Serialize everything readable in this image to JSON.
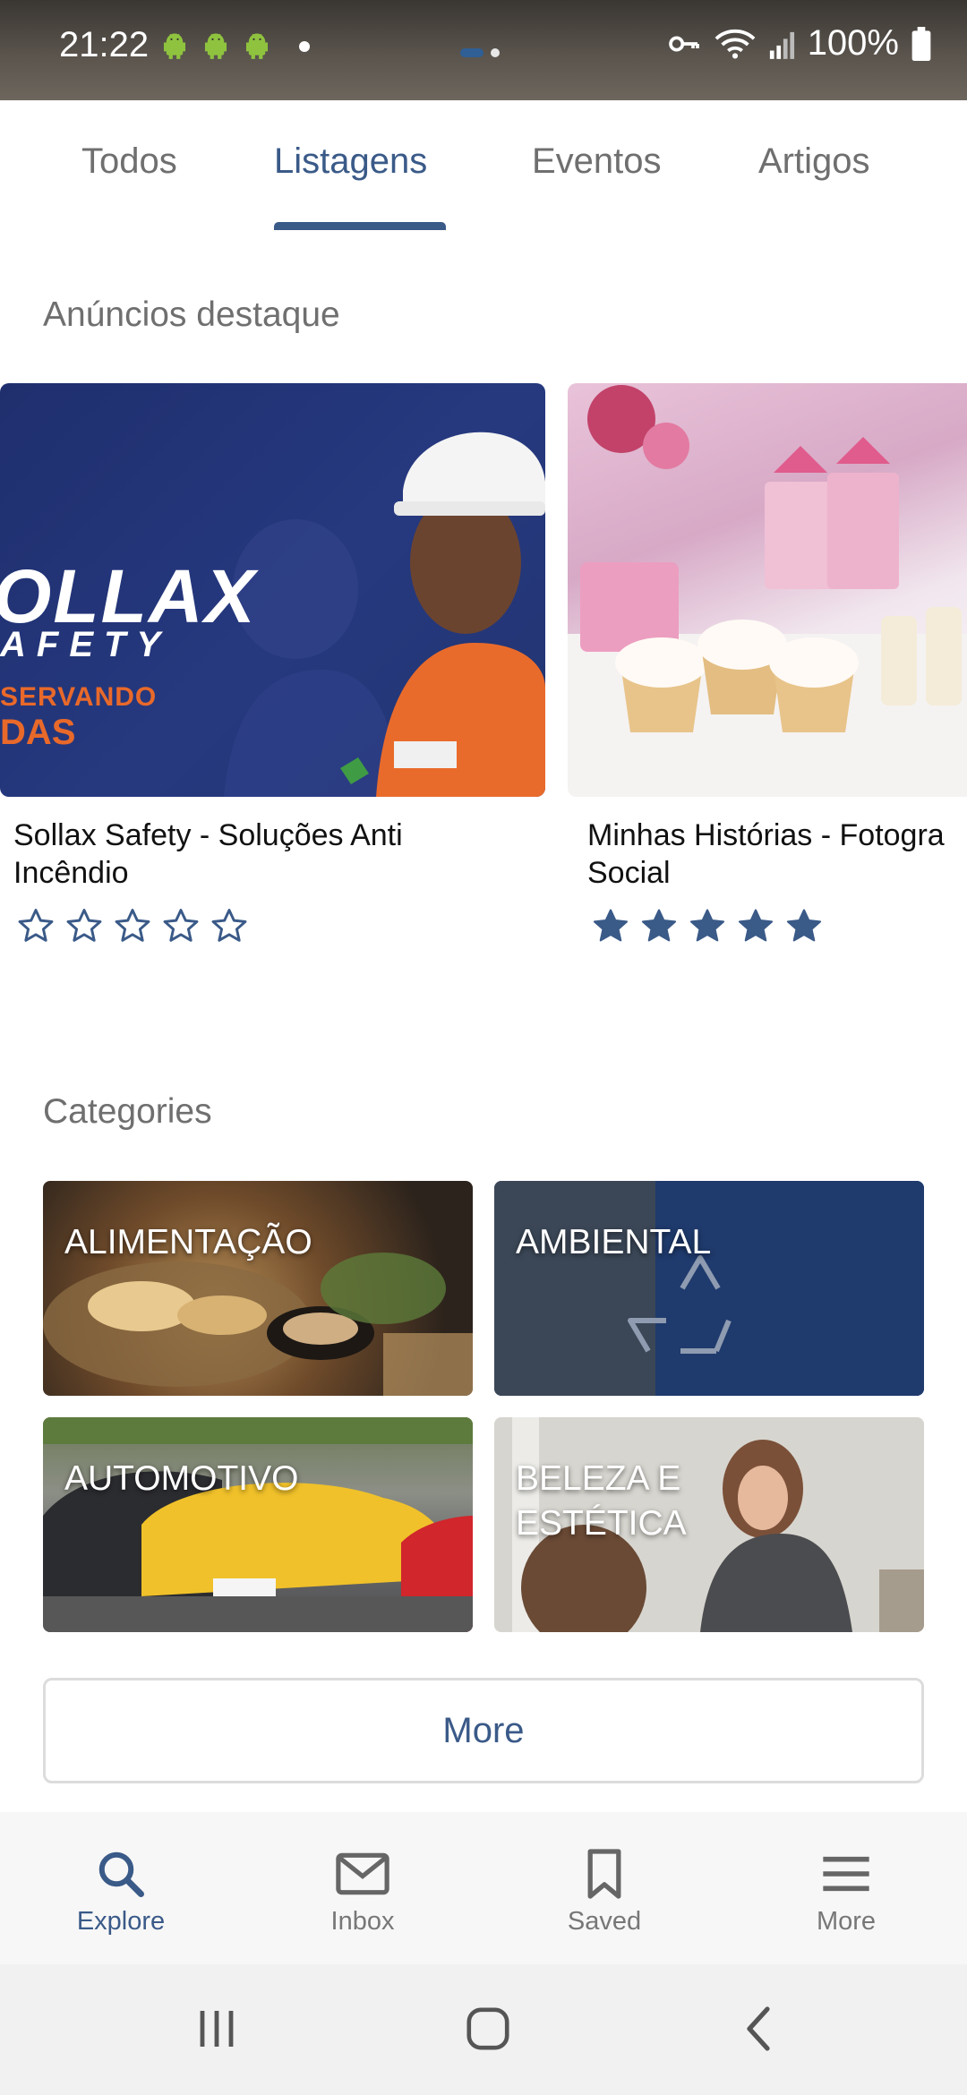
{
  "status_bar": {
    "time": "21:22",
    "battery": "100%",
    "icons": [
      "android-icon",
      "android-icon",
      "android-icon",
      "notification-dot",
      "key-icon",
      "wifi-icon",
      "signal-icon",
      "battery-icon"
    ]
  },
  "tabs": [
    {
      "label": "Todos",
      "active": false
    },
    {
      "label": "Listagens",
      "active": true
    },
    {
      "label": "Eventos",
      "active": false
    },
    {
      "label": "Artigos",
      "active": false
    }
  ],
  "featured": {
    "title": "Anúncios destaque",
    "cards": [
      {
        "title": "Sollax Safety - Soluções Anti\nIncêndio",
        "rating": 0,
        "max_rating": 5,
        "image_text": {
          "logo": "OLLAX",
          "sub": "AFETY",
          "tag1": "SERVANDO",
          "tag2": "DAS"
        }
      },
      {
        "title": "Minhas Histórias - Fotogra\nSocial",
        "rating": 5,
        "max_rating": 5
      }
    ]
  },
  "categories": {
    "title": "Categories",
    "items": [
      {
        "label": "ALIMENTAÇÃO"
      },
      {
        "label": "AMBIENTAL"
      },
      {
        "label": "AUTOMOTIVO"
      },
      {
        "label": "BELEZA E\nESTÉTICA"
      }
    ],
    "more_label": "More"
  },
  "bottom_nav": [
    {
      "label": "Explore",
      "icon": "search-icon",
      "active": true
    },
    {
      "label": "Inbox",
      "icon": "mail-icon",
      "active": false
    },
    {
      "label": "Saved",
      "icon": "bookmark-icon",
      "active": false
    },
    {
      "label": "More",
      "icon": "menu-icon",
      "active": false
    }
  ],
  "colors": {
    "accent": "#3a5a88",
    "muted_text": "#6f6f6f",
    "star_fill": "#3a5a88"
  },
  "system_nav": [
    "recents-icon",
    "home-icon",
    "back-icon"
  ]
}
